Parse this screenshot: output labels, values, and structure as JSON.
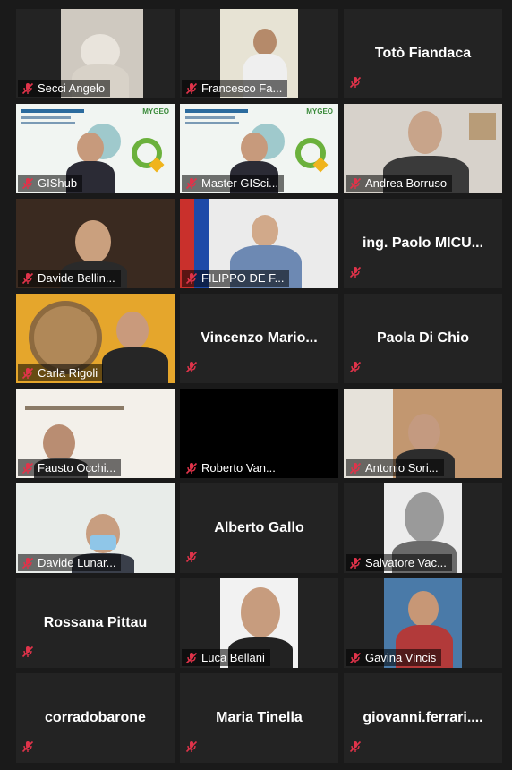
{
  "participants": [
    {
      "name": "Secci Angelo",
      "video": "cap"
    },
    {
      "name": "Francesco Fa...",
      "video": "outdoor"
    },
    {
      "name": "Totò Fiandaca",
      "video": null
    },
    {
      "name": "GIShub",
      "video": "slide"
    },
    {
      "name": "Master GISci...",
      "video": "slide"
    },
    {
      "name": "Andrea Borruso",
      "video": "room",
      "active": true
    },
    {
      "name": "Davide Bellin...",
      "video": "dark"
    },
    {
      "name": "FILIPPO DE F...",
      "video": "office"
    },
    {
      "name": "ing. Paolo MICU...",
      "video": null
    },
    {
      "name": "Carla Rigoli",
      "video": "yellow"
    },
    {
      "name": "Vincenzo Mario...",
      "video": null
    },
    {
      "name": "Paola Di Chio",
      "video": null
    },
    {
      "name": "Fausto Occhi...",
      "video": "shelf"
    },
    {
      "name": "Roberto Van...",
      "video": "black"
    },
    {
      "name": "Antonio Sori...",
      "video": "wood"
    },
    {
      "name": "Davide Lunar...",
      "video": "bright"
    },
    {
      "name": "Alberto Gallo",
      "video": null
    },
    {
      "name": "Salvatore Vac...",
      "video": "sketch"
    },
    {
      "name": "Rossana Pittau",
      "video": null
    },
    {
      "name": "Luca Bellani",
      "video": "portrait"
    },
    {
      "name": "Gavina Vincis",
      "video": "photo"
    },
    {
      "name": "corradobarone",
      "video": null
    },
    {
      "name": "Maria Tinella",
      "video": null
    },
    {
      "name": "giovanni.ferrari....",
      "video": null
    }
  ],
  "colors": {
    "tile_bg": "#232323",
    "active_border": "#c8e04a",
    "muted_icon": "#e0334a"
  },
  "icons": {
    "muted": "mic-muted-icon"
  }
}
